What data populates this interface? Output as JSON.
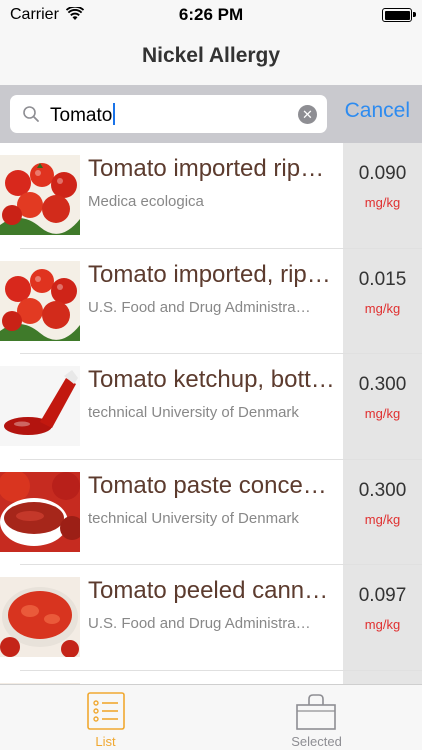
{
  "status_bar": {
    "carrier": "Carrier",
    "time": "6:26 PM"
  },
  "nav": {
    "title": "Nickel Allergy"
  },
  "search": {
    "value": "Tomato",
    "cancel_label": "Cancel"
  },
  "items": [
    {
      "name": "Tomato imported rip…",
      "source": "Medica ecologica",
      "value": "0.090",
      "unit": "mg/kg",
      "image": "fresh-tomatoes-image"
    },
    {
      "name": "Tomato imported, rip…",
      "source": "U.S. Food and Drug Administra…",
      "value": "0.015",
      "unit": "mg/kg",
      "image": "fresh-tomatoes-image"
    },
    {
      "name": "Tomato ketchup, bott…",
      "source": "technical University of Denmark",
      "value": "0.300",
      "unit": "mg/kg",
      "image": "ketchup-image"
    },
    {
      "name": "Tomato paste conce…",
      "source": "technical University of Denmark",
      "value": "0.300",
      "unit": "mg/kg",
      "image": "tomato-paste-image"
    },
    {
      "name": "Tomato peeled cann…",
      "source": "U.S. Food and Drug Administra…",
      "value": "0.097",
      "unit": "mg/kg",
      "image": "peeled-tomatoes-image"
    }
  ],
  "tabs": [
    {
      "label": "List",
      "icon": "list-icon",
      "active": true
    },
    {
      "label": "Selected",
      "icon": "basket-icon",
      "active": false
    }
  ],
  "colors": {
    "accent_blue": "#2d8bf0",
    "tab_active": "#f0a830",
    "tab_inactive": "#8e8e93",
    "unit_red": "#e03030",
    "item_name": "#5c3b2e"
  }
}
